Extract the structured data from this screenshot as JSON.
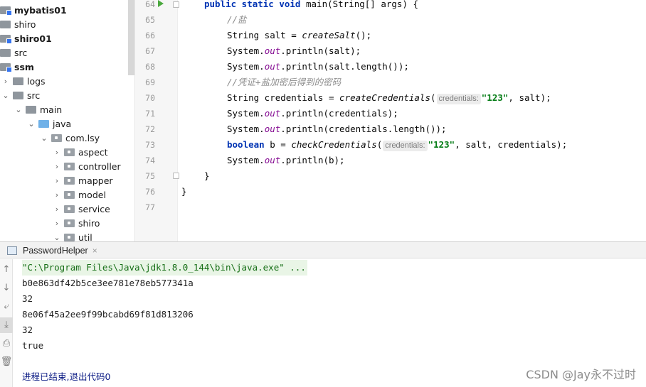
{
  "project_tree": {
    "items": [
      {
        "label": "mybatis01",
        "bold": true
      },
      {
        "label": "shiro",
        "bold": false
      },
      {
        "label": "shiro01",
        "bold": true
      },
      {
        "label": "src",
        "bold": false
      },
      {
        "label": "ssm",
        "bold": true
      },
      {
        "label": "logs",
        "bold": false
      },
      {
        "label": "src",
        "bold": false
      },
      {
        "label": "main",
        "bold": false
      },
      {
        "label": "java",
        "bold": false
      },
      {
        "label": "com.lsy",
        "bold": false
      },
      {
        "label": "aspect",
        "bold": false
      },
      {
        "label": "controller",
        "bold": false
      },
      {
        "label": "mapper",
        "bold": false
      },
      {
        "label": "model",
        "bold": false
      },
      {
        "label": "service",
        "bold": false
      },
      {
        "label": "shiro",
        "bold": false
      },
      {
        "label": "util",
        "bold": false
      }
    ]
  },
  "editor": {
    "line_numbers": [
      "64",
      "65",
      "66",
      "67",
      "68",
      "69",
      "70",
      "71",
      "72",
      "73",
      "74",
      "75",
      "76",
      "77"
    ],
    "code": {
      "l64_kw": "public static void",
      "l64_rest": " main(String[] args) {",
      "l65": "//盐",
      "l66_a": "String salt = ",
      "l66_b": "createSalt",
      "l66_c": "();",
      "sys": "System.",
      "out": "out",
      "l67_tail": ".println(salt);",
      "l68_tail": ".println(salt.length());",
      "l69": "//凭证+盐加密后得到的密码",
      "l70_a": "String credentials = ",
      "l70_b": "createCredentials",
      "l70_c": "(",
      "hint_credentials": "credentials:",
      "str_123": "\"123\"",
      "l70_d": ", salt);",
      "l71_tail": ".println(credentials);",
      "l72_tail": ".println(credentials.length());",
      "l73_kw": "boolean",
      "l73_a": " b = ",
      "l73_b": "checkCredentials",
      "l73_c": "(",
      "l73_d": ", salt, credentials);",
      "l74_tail": ".println(b);",
      "close_brace": "}"
    }
  },
  "run_panel": {
    "tab_label": "PasswordHelper",
    "tab_close": "×",
    "output": {
      "command": "\"C:\\Program Files\\Java\\jdk1.8.0_144\\bin\\java.exe\" ...",
      "salt": "b0e863df42b5ce3ee781e78eb577341a",
      "salt_length": "32",
      "credentials": "8e06f45a2ee9f99bcabd69f81d813206",
      "credentials_length": "32",
      "check_result": "true",
      "exit_message": "进程已结束,退出代码0"
    }
  },
  "watermark": "CSDN @Jay永不过时",
  "colors": {
    "keyword": "#0033b3",
    "string": "#067d17",
    "comment": "#8c8c8c",
    "static_field": "#871094",
    "run_icon": "#4aa83d"
  }
}
